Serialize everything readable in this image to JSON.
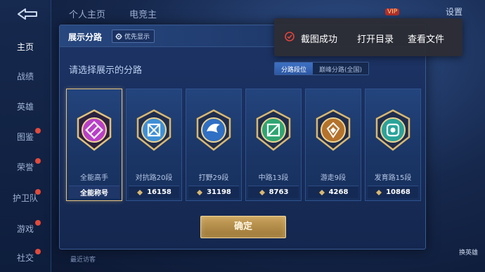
{
  "sidebar": {
    "items": [
      {
        "label": "主页",
        "active": true,
        "dot": false
      },
      {
        "label": "战绩",
        "active": false,
        "dot": false
      },
      {
        "label": "英雄",
        "active": false,
        "dot": false
      },
      {
        "label": "图鉴",
        "active": false,
        "dot": true
      },
      {
        "label": "荣誉",
        "active": false,
        "dot": true
      },
      {
        "label": "护卫队",
        "active": false,
        "dot": true
      },
      {
        "label": "游戏",
        "active": false,
        "dot": true
      },
      {
        "label": "社交",
        "active": false,
        "dot": true
      }
    ]
  },
  "topbar": {
    "tabs": [
      "个人主页",
      "电竞主"
    ],
    "settings": "设置",
    "vip": "VIP"
  },
  "dialog": {
    "title": "展示分路",
    "priority_button": "优先显示",
    "prompt": "请选择展示的分路",
    "tabs": [
      {
        "label": "分路段位",
        "active": true
      },
      {
        "label": "巅峰分路(全国)",
        "active": false
      }
    ],
    "cards": [
      {
        "name": "全能高手",
        "foot": "全能称号",
        "points": null,
        "selected": true,
        "emblem": "allround-emblem-icon",
        "color": "#b93fc8"
      },
      {
        "name": "对抗路20段",
        "foot": "16158",
        "points": "16158",
        "selected": false,
        "emblem": "clash-lane-emblem-icon",
        "color": "#3e8fd6"
      },
      {
        "name": "打野29段",
        "foot": "31198",
        "points": "31198",
        "selected": false,
        "emblem": "jungle-emblem-icon",
        "color": "#2f6fc4"
      },
      {
        "name": "中路13段",
        "foot": "8763",
        "points": "8763",
        "selected": false,
        "emblem": "mid-lane-emblem-icon",
        "color": "#2ea573"
      },
      {
        "name": "游走9段",
        "foot": "4268",
        "points": "4268",
        "selected": false,
        "emblem": "roam-emblem-icon",
        "color": "#b4722c"
      },
      {
        "name": "发育路15段",
        "foot": "10868",
        "points": "10868",
        "selected": false,
        "emblem": "farm-lane-emblem-icon",
        "color": "#2aa39a"
      }
    ],
    "confirm": "确定"
  },
  "toast": {
    "message": "截图成功",
    "open_folder": "打开目录",
    "view_file": "查看文件"
  },
  "bottom": {
    "hint": "最近访客",
    "right_badge": "换英雄"
  }
}
